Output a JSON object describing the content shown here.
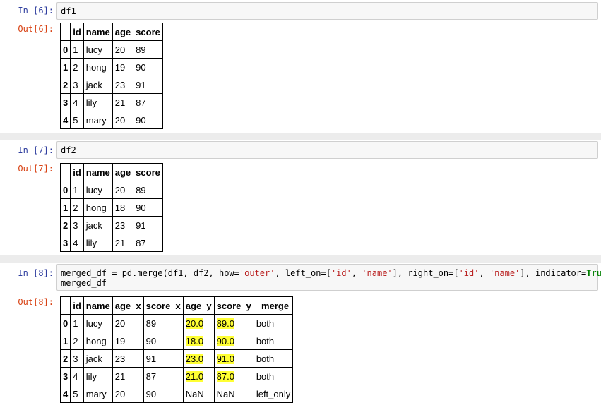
{
  "cells": [
    {
      "in_prompt": "In [6]:",
      "out_prompt": "Out[6]:",
      "code": "df1",
      "table": {
        "columns": [
          "",
          "id",
          "name",
          "age",
          "score"
        ],
        "rows": [
          [
            "0",
            "1",
            "lucy",
            "20",
            "89"
          ],
          [
            "1",
            "2",
            "hong",
            "19",
            "90"
          ],
          [
            "2",
            "3",
            "jack",
            "23",
            "91"
          ],
          [
            "3",
            "4",
            "lily",
            "21",
            "87"
          ],
          [
            "4",
            "5",
            "mary",
            "20",
            "90"
          ]
        ]
      }
    },
    {
      "in_prompt": "In [7]:",
      "out_prompt": "Out[7]:",
      "code": "df2",
      "table": {
        "columns": [
          "",
          "id",
          "name",
          "age",
          "score"
        ],
        "rows": [
          [
            "0",
            "1",
            "lucy",
            "20",
            "89"
          ],
          [
            "1",
            "2",
            "hong",
            "18",
            "90"
          ],
          [
            "2",
            "3",
            "jack",
            "23",
            "91"
          ],
          [
            "3",
            "4",
            "lily",
            "21",
            "87"
          ]
        ]
      }
    },
    {
      "in_prompt": "In [8]:",
      "out_prompt": "Out[8]:",
      "code_line1_parts": [
        "merged_df = pd.merge(df1, df2, how=",
        "'outer'",
        ", left_on=[",
        "'id'",
        ", ",
        "'name'",
        "], right_on=[",
        "'id'",
        ", ",
        "'name'",
        "], indicator=",
        "True",
        ")"
      ],
      "code_line2": "merged_df",
      "table": {
        "columns": [
          "",
          "id",
          "name",
          "age_x",
          "score_x",
          "age_y",
          "score_y",
          "_merge"
        ],
        "rows": [
          [
            "0",
            "1",
            "lucy",
            "20",
            "89",
            "20.0",
            "89.0",
            "both"
          ],
          [
            "1",
            "2",
            "hong",
            "19",
            "90",
            "18.0",
            "90.0",
            "both"
          ],
          [
            "2",
            "3",
            "jack",
            "23",
            "91",
            "23.0",
            "91.0",
            "both"
          ],
          [
            "3",
            "4",
            "lily",
            "21",
            "87",
            "21.0",
            "87.0",
            "both"
          ],
          [
            "4",
            "5",
            "mary",
            "20",
            "90",
            "NaN",
            "NaN",
            "left_only"
          ]
        ],
        "highlighted_columns": [
          5,
          6
        ],
        "highlighted_rows": [
          0,
          1,
          2,
          3
        ],
        "highlight_color": "#ffff33"
      }
    }
  ]
}
